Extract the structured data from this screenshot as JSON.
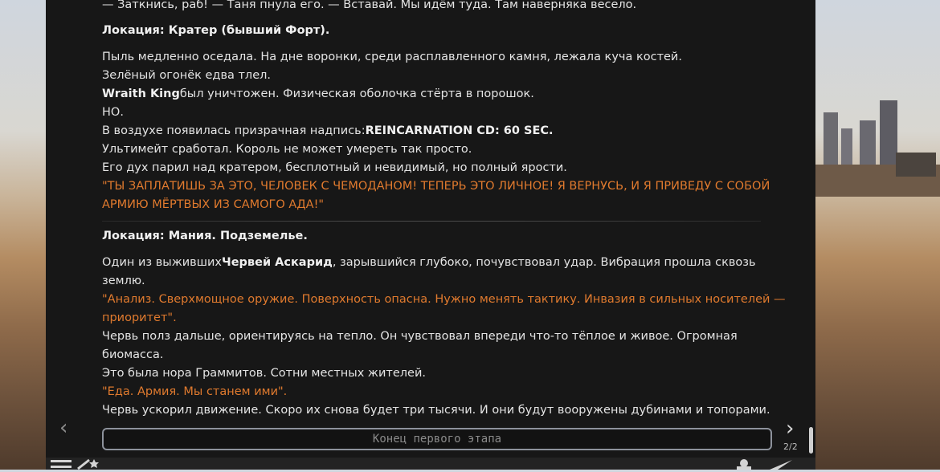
{
  "story": {
    "line_top": "— Заткнись, раб! — Таня пнула его. — Вставай. Мы идём туда. Там наверняка весело.",
    "section1": {
      "location": "Локация: Кратер (бывший Форт).",
      "l1": "Пыль медленно оседала. На дне воронки, среди расплавленного камня, лежала куча костей.",
      "l2": "Зелёный огонёк едва тлел.",
      "l3_bold": "Wraith King",
      "l3_rest": "был уничтожен. Физическая оболочка стёрта в порошок.",
      "l4": "НО.",
      "l5_pre": "В воздухе появилась призрачная надпись:",
      "l5_bold": "REINCARNATION CD: 60 SEC.",
      "l6": "Ультимейт сработал. Король не может умереть так просто.",
      "l7": "Его дух парил над кратером, бесплотный и невидимый, но полный ярости.",
      "quote_a": "\"ТЫ ЗАПЛАТИШЬ ЗА ЭТО, ЧЕЛОВЕК С ЧЕМОДАНОМ! ТЕПЕРЬ ЭТО ЛИЧНОЕ! Я ВЕРНУСЬ, И Я ПРИВЕДУ С СОБОЙ",
      "quote_b": "АРМИЮ МЁРТВЫХ ИЗ САМОГО АДА!\""
    },
    "section2": {
      "location": "Локация: Мания. Подземелье.",
      "p1_pre": "Один из выживших",
      "p1_bold": "Червей Аскарид",
      "p1_rest": ", зарывшийся глубоко, почувствовал удар. Вибрация прошла сквозь",
      "p1_cont": "землю.",
      "q1_a": "\"Анализ. Сверхмощное оружие. Поверхность опасна. Нужно менять тактику. Инвазия в сильных носителей —",
      "q1_b": "приоритет\".",
      "p2_a": "Червь полз дальше, ориентируясь на тепло. Он чувствовал впереди что-то тёплое и живое. Огромная",
      "p2_b": "биомасса.",
      "p3": "Это была нора Граммитов. Сотни местных жителей.",
      "q2": "\"Еда. Армия. Мы станем ими\".",
      "p4": "Червь ускорил движение. Скоро их снова будет три тысячи. И они будут вооружены дубинами и топорами."
    }
  },
  "nav": {
    "prev_icon": "‹",
    "next_icon": "›",
    "counter": "2/2"
  },
  "input": {
    "placeholder": "Конец первого этапа"
  },
  "icons": {
    "menu": "menu-icon",
    "magic": "magic-wand-icon",
    "send": "send-icon",
    "persona": "persona-icon"
  },
  "colors": {
    "panel": "#171717",
    "text": "#e4e4e4",
    "quote": "#e07a2e"
  }
}
